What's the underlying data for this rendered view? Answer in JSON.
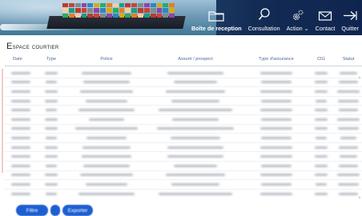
{
  "header": {
    "nav": [
      {
        "label": "Boîte de reception",
        "icon": "folder-icon",
        "bold": true
      },
      {
        "label": "Consultation",
        "icon": "search-icon",
        "bold": false
      },
      {
        "label": "Action",
        "icon": "gear-icon",
        "bold": false,
        "suffix": "⌄"
      },
      {
        "label": "Contact",
        "icon": "mail-icon",
        "bold": false
      },
      {
        "label": "Quitter",
        "icon": "exit-arrow-icon",
        "bold": false
      }
    ]
  },
  "section_title": "Espace courtier",
  "table": {
    "columns": [
      "Date",
      "Type",
      "Police",
      "Assuré / prospect",
      "Type d'assurance",
      "CIG",
      "Statut"
    ],
    "row_count": 15
  },
  "footer": {
    "filter_label": "Filtre",
    "small_label": "",
    "export_label": "Exporter"
  },
  "colors": {
    "accent": "#1d5fd1",
    "header_dark": "#132c54",
    "column_header_text": "#4a6a9c"
  }
}
